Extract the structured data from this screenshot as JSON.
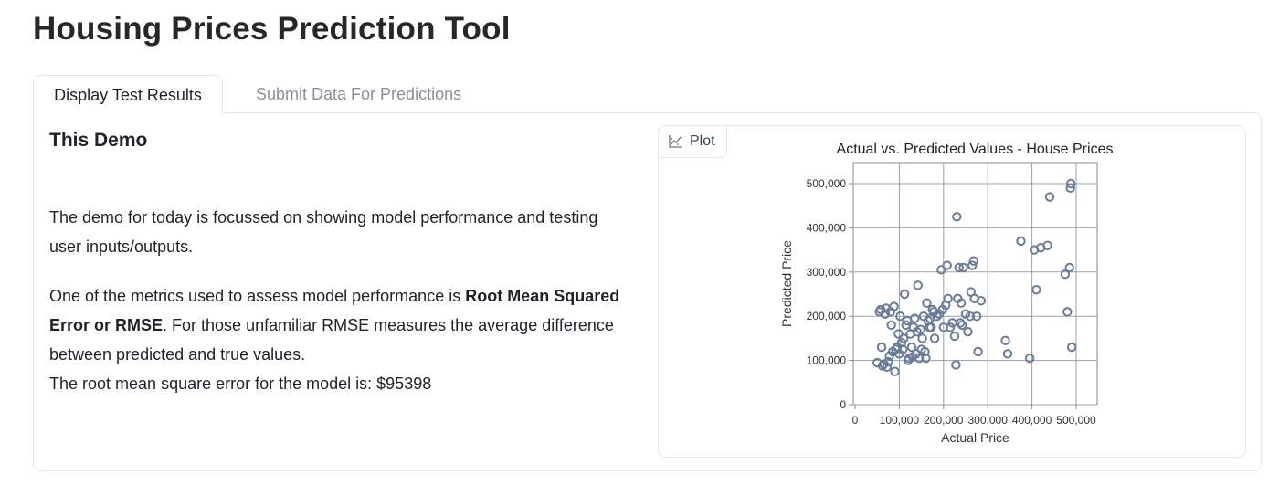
{
  "app": {
    "title": "Housing Prices Prediction Tool"
  },
  "tabs": [
    {
      "label": "Display Test Results",
      "active": true
    },
    {
      "label": "Submit Data For Predictions",
      "active": false
    }
  ],
  "demo": {
    "heading": "This Demo",
    "paragraph1": "The demo for today is focussed on showing model performance and testing user inputs/outputs.",
    "paragraph2_prefix": "One of the metrics used to assess model performance is ",
    "paragraph2_bold": "Root Mean Squared Error or RMSE",
    "paragraph2_suffix": ". For those unfamiliar RMSE measures the average difference between predicted and true values.",
    "rmse_line": "The root mean square error for the model is: $95398"
  },
  "plot_block": {
    "label": "Plot",
    "icon": "chart-icon"
  },
  "chart_data": {
    "type": "scatter",
    "title": "Actual vs. Predicted Values - House Prices",
    "xlabel": "Actual Price",
    "ylabel": "Predicted Price",
    "xlim": [
      0,
      500000
    ],
    "ylim": [
      0,
      520000
    ],
    "x_ticks": [
      0,
      100000,
      200000,
      300000,
      400000,
      500000
    ],
    "x_tick_labels": [
      "0",
      "100,000",
      "200,000",
      "300,000",
      "400,000",
      "500,000"
    ],
    "y_ticks": [
      0,
      100000,
      200000,
      300000,
      400000,
      500000
    ],
    "y_tick_labels": [
      "0",
      "100,000",
      "200,000",
      "300,000",
      "400,000",
      "500,000"
    ],
    "grid": true,
    "marker_color": "#6b7b9a",
    "points": [
      [
        50000,
        95000
      ],
      [
        55000,
        210000
      ],
      [
        58000,
        215000
      ],
      [
        60000,
        130000
      ],
      [
        62000,
        88000
      ],
      [
        65000,
        92000
      ],
      [
        68000,
        205000
      ],
      [
        70000,
        218000
      ],
      [
        72000,
        85000
      ],
      [
        75000,
        97000
      ],
      [
        78000,
        110000
      ],
      [
        80000,
        210000
      ],
      [
        82000,
        180000
      ],
      [
        85000,
        120000
      ],
      [
        88000,
        222000
      ],
      [
        90000,
        75000
      ],
      [
        92000,
        125000
      ],
      [
        95000,
        130000
      ],
      [
        98000,
        160000
      ],
      [
        100000,
        115000
      ],
      [
        102000,
        200000
      ],
      [
        105000,
        140000
      ],
      [
        108000,
        125000
      ],
      [
        110000,
        150000
      ],
      [
        112000,
        250000
      ],
      [
        115000,
        180000
      ],
      [
        118000,
        190000
      ],
      [
        120000,
        100000
      ],
      [
        122000,
        105000
      ],
      [
        125000,
        160000
      ],
      [
        128000,
        130000
      ],
      [
        130000,
        108000
      ],
      [
        132000,
        175000
      ],
      [
        135000,
        195000
      ],
      [
        138000,
        115000
      ],
      [
        140000,
        165000
      ],
      [
        142000,
        270000
      ],
      [
        145000,
        105000
      ],
      [
        148000,
        170000
      ],
      [
        150000,
        125000
      ],
      [
        152000,
        150000
      ],
      [
        155000,
        200000
      ],
      [
        158000,
        120000
      ],
      [
        160000,
        105000
      ],
      [
        162000,
        230000
      ],
      [
        165000,
        190000
      ],
      [
        168000,
        175000
      ],
      [
        170000,
        195000
      ],
      [
        172000,
        175000
      ],
      [
        175000,
        215000
      ],
      [
        178000,
        210000
      ],
      [
        180000,
        150000
      ],
      [
        185000,
        200000
      ],
      [
        190000,
        205000
      ],
      [
        195000,
        305000
      ],
      [
        198000,
        215000
      ],
      [
        200000,
        175000
      ],
      [
        205000,
        225000
      ],
      [
        208000,
        315000
      ],
      [
        210000,
        240000
      ],
      [
        215000,
        175000
      ],
      [
        220000,
        185000
      ],
      [
        225000,
        155000
      ],
      [
        228000,
        90000
      ],
      [
        230000,
        425000
      ],
      [
        232000,
        240000
      ],
      [
        235000,
        310000
      ],
      [
        238000,
        185000
      ],
      [
        240000,
        230000
      ],
      [
        242000,
        180000
      ],
      [
        245000,
        310000
      ],
      [
        250000,
        205000
      ],
      [
        255000,
        165000
      ],
      [
        260000,
        200000
      ],
      [
        262000,
        255000
      ],
      [
        265000,
        315000
      ],
      [
        268000,
        325000
      ],
      [
        270000,
        240000
      ],
      [
        275000,
        200000
      ],
      [
        278000,
        120000
      ],
      [
        285000,
        235000
      ],
      [
        340000,
        145000
      ],
      [
        345000,
        115000
      ],
      [
        375000,
        370000
      ],
      [
        395000,
        105000
      ],
      [
        405000,
        350000
      ],
      [
        410000,
        260000
      ],
      [
        420000,
        355000
      ],
      [
        435000,
        360000
      ],
      [
        440000,
        470000
      ],
      [
        475000,
        295000
      ],
      [
        480000,
        210000
      ],
      [
        485000,
        310000
      ],
      [
        487000,
        490000
      ],
      [
        488000,
        500000
      ],
      [
        490000,
        130000
      ]
    ]
  }
}
